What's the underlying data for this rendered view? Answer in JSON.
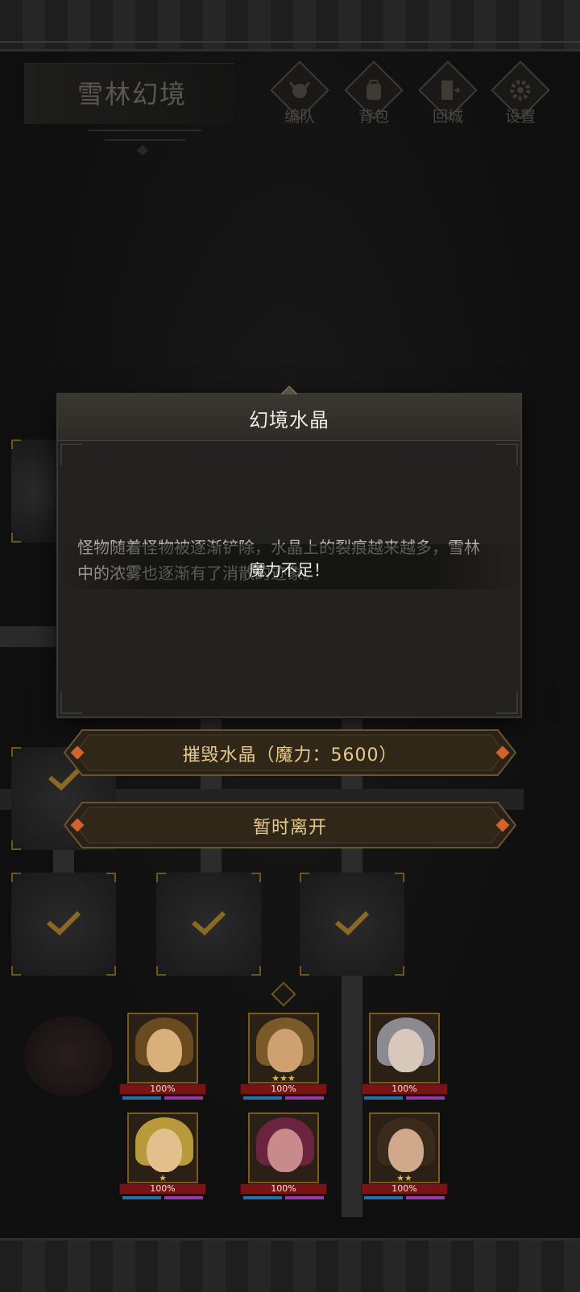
{
  "header": {
    "title": "雪林幻境",
    "menu": [
      {
        "label": "编队",
        "icon": "skull-helmet-icon"
      },
      {
        "label": "背包",
        "icon": "backpack-icon"
      },
      {
        "label": "回城",
        "icon": "door-return-icon"
      },
      {
        "label": "设置",
        "icon": "gear-icon"
      }
    ]
  },
  "dialog": {
    "title": "幻境水晶",
    "body": "怪物随着怪物被逐渐铲除，水晶上的裂痕越来越多，雪林中的浓雾也逐渐有了消散的迹象。",
    "toast": "魔力不足！"
  },
  "actions": {
    "destroy_label": "摧毁水晶（魔力：5600）",
    "leave_label": "暂时离开"
  },
  "party": [
    {
      "hp_text": "100%",
      "hp": 1.0,
      "stars": 0
    },
    {
      "hp_text": "100%",
      "hp": 1.0,
      "stars": 3
    },
    {
      "hp_text": "100%",
      "hp": 1.0,
      "stars": 0
    },
    {
      "hp_text": "100%",
      "hp": 1.0,
      "stars": 1
    },
    {
      "hp_text": "100%",
      "hp": 1.0,
      "stars": 0
    },
    {
      "hp_text": "100%",
      "hp": 1.0,
      "stars": 2
    }
  ],
  "colors": {
    "gold_accent": "#e6c98e",
    "hp_red": "#7a1414",
    "mana_blue": "#2b6fa8",
    "mana_purple": "#9a3aa8"
  }
}
